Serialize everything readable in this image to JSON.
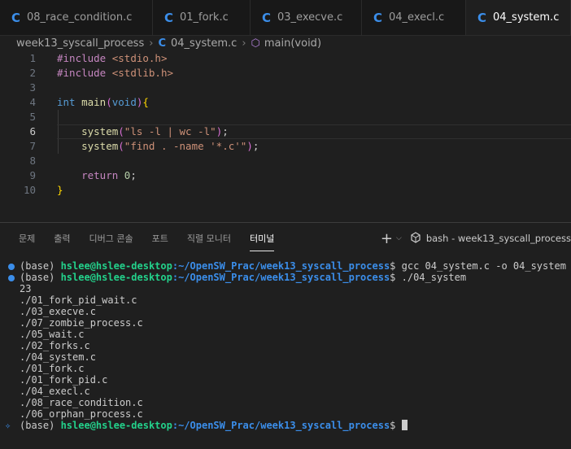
{
  "tabs": [
    {
      "icon": "c-file-icon",
      "label": "08_race_condition.c",
      "active": false
    },
    {
      "icon": "c-file-icon",
      "label": "01_fork.c",
      "active": false
    },
    {
      "icon": "c-file-icon",
      "label": "03_execve.c",
      "active": false
    },
    {
      "icon": "c-file-icon",
      "label": "04_execl.c",
      "active": false
    },
    {
      "icon": "c-file-icon",
      "label": "04_system.c",
      "active": true
    }
  ],
  "breadcrumb": {
    "folder": "week13_syscall_process",
    "file": "04_system.c",
    "symbol": "main(void)"
  },
  "editor": {
    "current_line": 6,
    "lines": [
      {
        "n": "1"
      },
      {
        "n": "2"
      },
      {
        "n": "3"
      },
      {
        "n": "4"
      },
      {
        "n": "5"
      },
      {
        "n": "6"
      },
      {
        "n": "7"
      },
      {
        "n": "8"
      },
      {
        "n": "9"
      },
      {
        "n": "10"
      }
    ],
    "tokens": {
      "l1_pre": "#include",
      "l1_inc": "<stdio.h>",
      "l2_pre": "#include",
      "l2_inc": "<stdlib.h>",
      "l4_type": "int",
      "l4_fn": "main",
      "l4_open": "(",
      "l4_arg": "void",
      "l4_close": ")",
      "l4_brace": "{",
      "l6_fn": "system",
      "l6_open": "(",
      "l6_str": "\"ls -l | wc -l\"",
      "l6_close": ")",
      "l6_semi": ";",
      "l7_fn": "system",
      "l7_open": "(",
      "l7_str": "\"find . -name '*.c'\"",
      "l7_close": ")",
      "l7_semi": ";",
      "l9_kw": "return",
      "l9_num": "0",
      "l9_semi": ";",
      "l10_brace": "}"
    }
  },
  "panel": {
    "tabs": [
      "문제",
      "출력",
      "디버그 콘솔",
      "포트",
      "직렬 모니터",
      "터미널"
    ],
    "active_tab": "터미널",
    "terminal_name": "bash - week13_syscall_process"
  },
  "terminal": {
    "prompt_base": "(base) ",
    "prompt_user": "hslee@hslee-desktop",
    "prompt_path": ":~/OpenSW_Prac/week13_syscall_process",
    "prompt_end": "$ ",
    "cmd1": "gcc 04_system.c -o 04_system",
    "cmd2": "./04_system",
    "output": [
      "23",
      "./01_fork_pid_wait.c",
      "./03_execve.c",
      "./07_zombie_process.c",
      "./05_wait.c",
      "./02_forks.c",
      "./04_system.c",
      "./01_fork.c",
      "./01_fork_pid.c",
      "./04_execl.c",
      "./08_race_condition.c",
      "./06_orphan_process.c"
    ]
  },
  "colors": {
    "accent": "#3b8eea",
    "terminal_user": "#23d18b",
    "background": "#1f1f1f"
  }
}
